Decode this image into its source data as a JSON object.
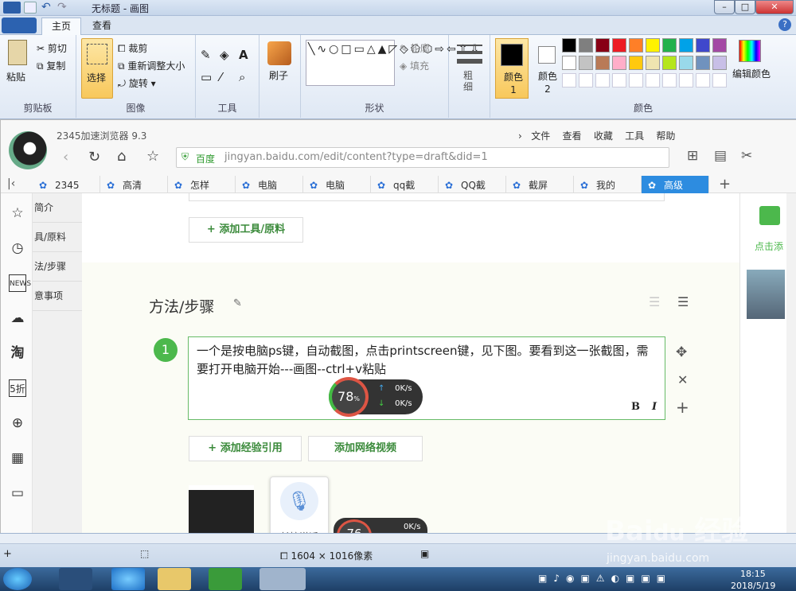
{
  "paint": {
    "title": "无标题 - 画图",
    "tabs": [
      "主页",
      "查看"
    ],
    "clipboard": {
      "paste": "粘贴",
      "cut": "剪切",
      "copy": "复制",
      "group": "剪贴板"
    },
    "image": {
      "select": "选择",
      "crop": "裁剪",
      "resize": "重新调整大小",
      "rotate": "旋转",
      "group": "图像"
    },
    "tools": {
      "group": "工具",
      "brush": "刷子"
    },
    "shapes": {
      "outline": "轮廓",
      "fill": "填充",
      "group": "形状"
    },
    "size": "粗细",
    "color1": "颜色 1",
    "color2": "颜色 2",
    "edit_colors": "编辑颜色",
    "colors_group": "颜色",
    "palette_row1": [
      "#000000",
      "#7f7f7f",
      "#880015",
      "#ed1c24",
      "#ff7f27",
      "#fff200",
      "#22b14c",
      "#00a2e8",
      "#3f48cc",
      "#a349a4"
    ],
    "palette_row2": [
      "#ffffff",
      "#c3c3c3",
      "#b97a57",
      "#ffaec9",
      "#ffc90e",
      "#efe4b0",
      "#b5e61d",
      "#99d9ea",
      "#7092be",
      "#c8bfe7"
    ],
    "status_size": "1604 × 1016像素"
  },
  "browser": {
    "name": "2345加速浏览器 9.3",
    "menu": [
      "文件",
      "查看",
      "收藏",
      "工具",
      "帮助"
    ],
    "site_label": "百度",
    "url": "jingyan.baidu.com/edit/content?type=draft&did=1",
    "tabs": [
      "2345",
      "高清",
      "怎样",
      "电脑",
      "电脑",
      "qq截",
      "QQ截",
      "截屏",
      "我的",
      "高级"
    ],
    "toc": [
      "简介",
      "具/原料",
      "法/步骤",
      "意事项"
    ],
    "add_tool": "+ 添加工具/原料",
    "section_title": "方法/步骤",
    "step_number": "1",
    "step_text": "一个是按电脑ps键，自动截图，点击printscreen键，见下图。要看到这一张截图，需要打开电脑开始---画图--ctrl+v粘贴",
    "add_ref": "+ 添加经验引用",
    "add_video": "添加网络视频",
    "speed_percent": "78",
    "speed_up": "0K/s",
    "speed_down": "0K/s",
    "speed_percent2": "76",
    "speed_up2": "0K/s",
    "voice": "长按说话",
    "side_text": "点击添"
  },
  "watermark": "jingyan.baidu.com",
  "taskbar": {
    "time": "18:15",
    "date": "2018/5/19"
  }
}
